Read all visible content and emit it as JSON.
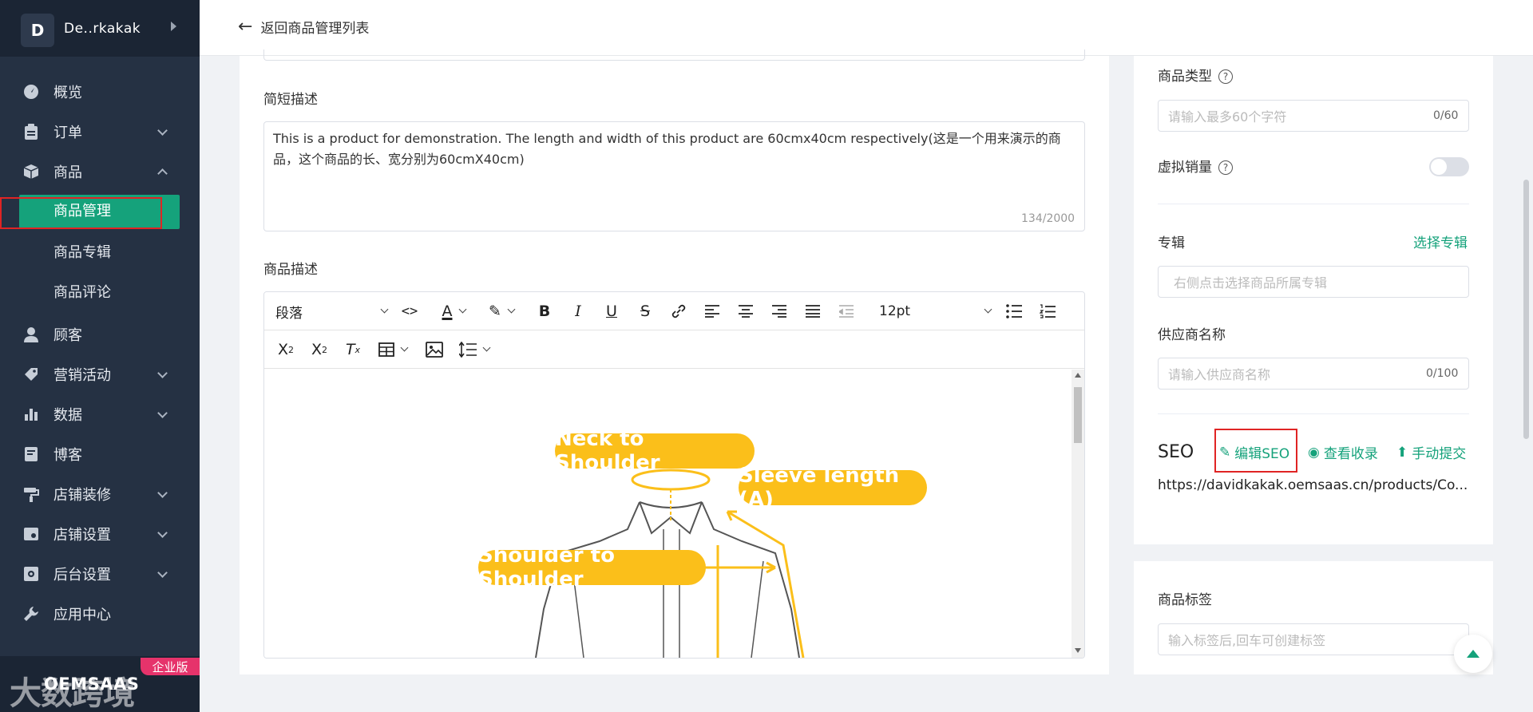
{
  "sidebar": {
    "brand_initial": "D",
    "brand_name": "De..rkakak",
    "items": [
      {
        "label": "概览",
        "icon": "dashboard-icon"
      },
      {
        "label": "订单",
        "icon": "clipboard-icon"
      },
      {
        "label": "商品",
        "icon": "box-icon"
      },
      {
        "label": "顾客",
        "icon": "user-icon"
      },
      {
        "label": "营销活动",
        "icon": "tag-icon"
      },
      {
        "label": "数据",
        "icon": "bar-chart-icon"
      },
      {
        "label": "博客",
        "icon": "blog-icon"
      },
      {
        "label": "店铺装修",
        "icon": "paint-roller-icon"
      },
      {
        "label": "店铺设置",
        "icon": "store-settings-icon"
      },
      {
        "label": "后台设置",
        "icon": "gear-icon"
      },
      {
        "label": "应用中心",
        "icon": "wrench-icon"
      }
    ],
    "sub_items": [
      "商品管理",
      "商品专辑",
      "商品评论"
    ],
    "enterprise_badge": "企业版",
    "product_name": "OEMSAAS",
    "watermark": "大数跨境"
  },
  "topbar": {
    "back_label": "返回商品管理列表"
  },
  "main": {
    "short_desc_label": "简短描述",
    "short_desc_text": "This is a product for demonstration. The length and width of this product are 60cmx40cm respectively(这是一个用来演示的商品，这个商品的长、宽分别为60cmX40cm)",
    "short_desc_count": "134/2000",
    "desc_label": "商品描述",
    "editor": {
      "paragraph_select": "段落",
      "font_size": "12pt"
    },
    "image_labels": {
      "neck": "Neck to Shoulder",
      "sleeve": "Sleeve length (A)",
      "shoulder": "Shoulder to Shoulder"
    }
  },
  "right": {
    "product_type_label": "商品类型",
    "product_type_placeholder": "请输入最多60个字符",
    "product_type_count": "0/60",
    "virtual_sales_label": "虚拟销量",
    "virtual_sales_on": false,
    "album_label": "专辑",
    "album_link": "选择专辑",
    "album_placeholder": "右侧点击选择商品所属专辑",
    "supplier_label": "供应商名称",
    "supplier_placeholder": "请输入供应商名称",
    "supplier_count": "0/100",
    "seo_label": "SEO",
    "seo_edit": "编辑SEO",
    "seo_view": "查看收录",
    "seo_submit": "手动提交",
    "seo_url": "https://davidkakak.oemsaas.cn/products/Co...",
    "tags_label": "商品标签",
    "tags_placeholder": "输入标签后,回车可创建标签"
  },
  "colors": {
    "accent": "#15a27b",
    "sidebar_bg": "#253143",
    "highlight_red": "#e02424",
    "pill_yellow": "#fbbf1a"
  }
}
